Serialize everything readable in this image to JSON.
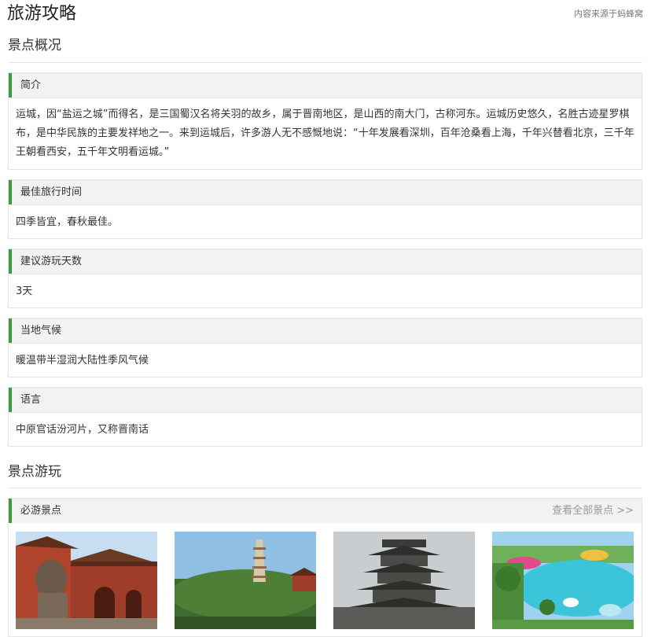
{
  "header": {
    "title": "旅游攻略",
    "source": "内容来源于蚂蜂窝"
  },
  "overview": {
    "title": "景点概况",
    "sections": [
      {
        "label": "简介",
        "content": "运城，因“盐运之城”而得名，是三国蜀汉名将关羽的故乡，属于晋南地区，是山西的南大门，古称河东。运城历史悠久，名胜古迹星罗棋布，是中华民族的主要发祥地之一。来到运城后，许多游人无不感慨地说：“十年发展看深圳，百年沧桑看上海，千年兴替看北京，三千年王朝看西安，五千年文明看运城。”"
      },
      {
        "label": "最佳旅行时间",
        "content": "四季皆宜，春秋最佳。"
      },
      {
        "label": "建议游玩天数",
        "content": "3天"
      },
      {
        "label": "当地气候",
        "content": "暖温带半湿润大陆性季风气候"
      },
      {
        "label": "语言",
        "content": "中原官话汾河片，又称晋南话"
      }
    ]
  },
  "play": {
    "title": "景点游玩",
    "must_visit": {
      "label": "必游景点",
      "view_all": "查看全部景点 >>"
    },
    "thumbnails": [
      "temple-gate-photo",
      "pagoda-hill-photo",
      "tower-pavilion-photo",
      "water-park-photo"
    ]
  },
  "colors": {
    "accent": "#3a9c3a",
    "header_bg": "#f2f2f2",
    "border": "#e4e4e4"
  }
}
